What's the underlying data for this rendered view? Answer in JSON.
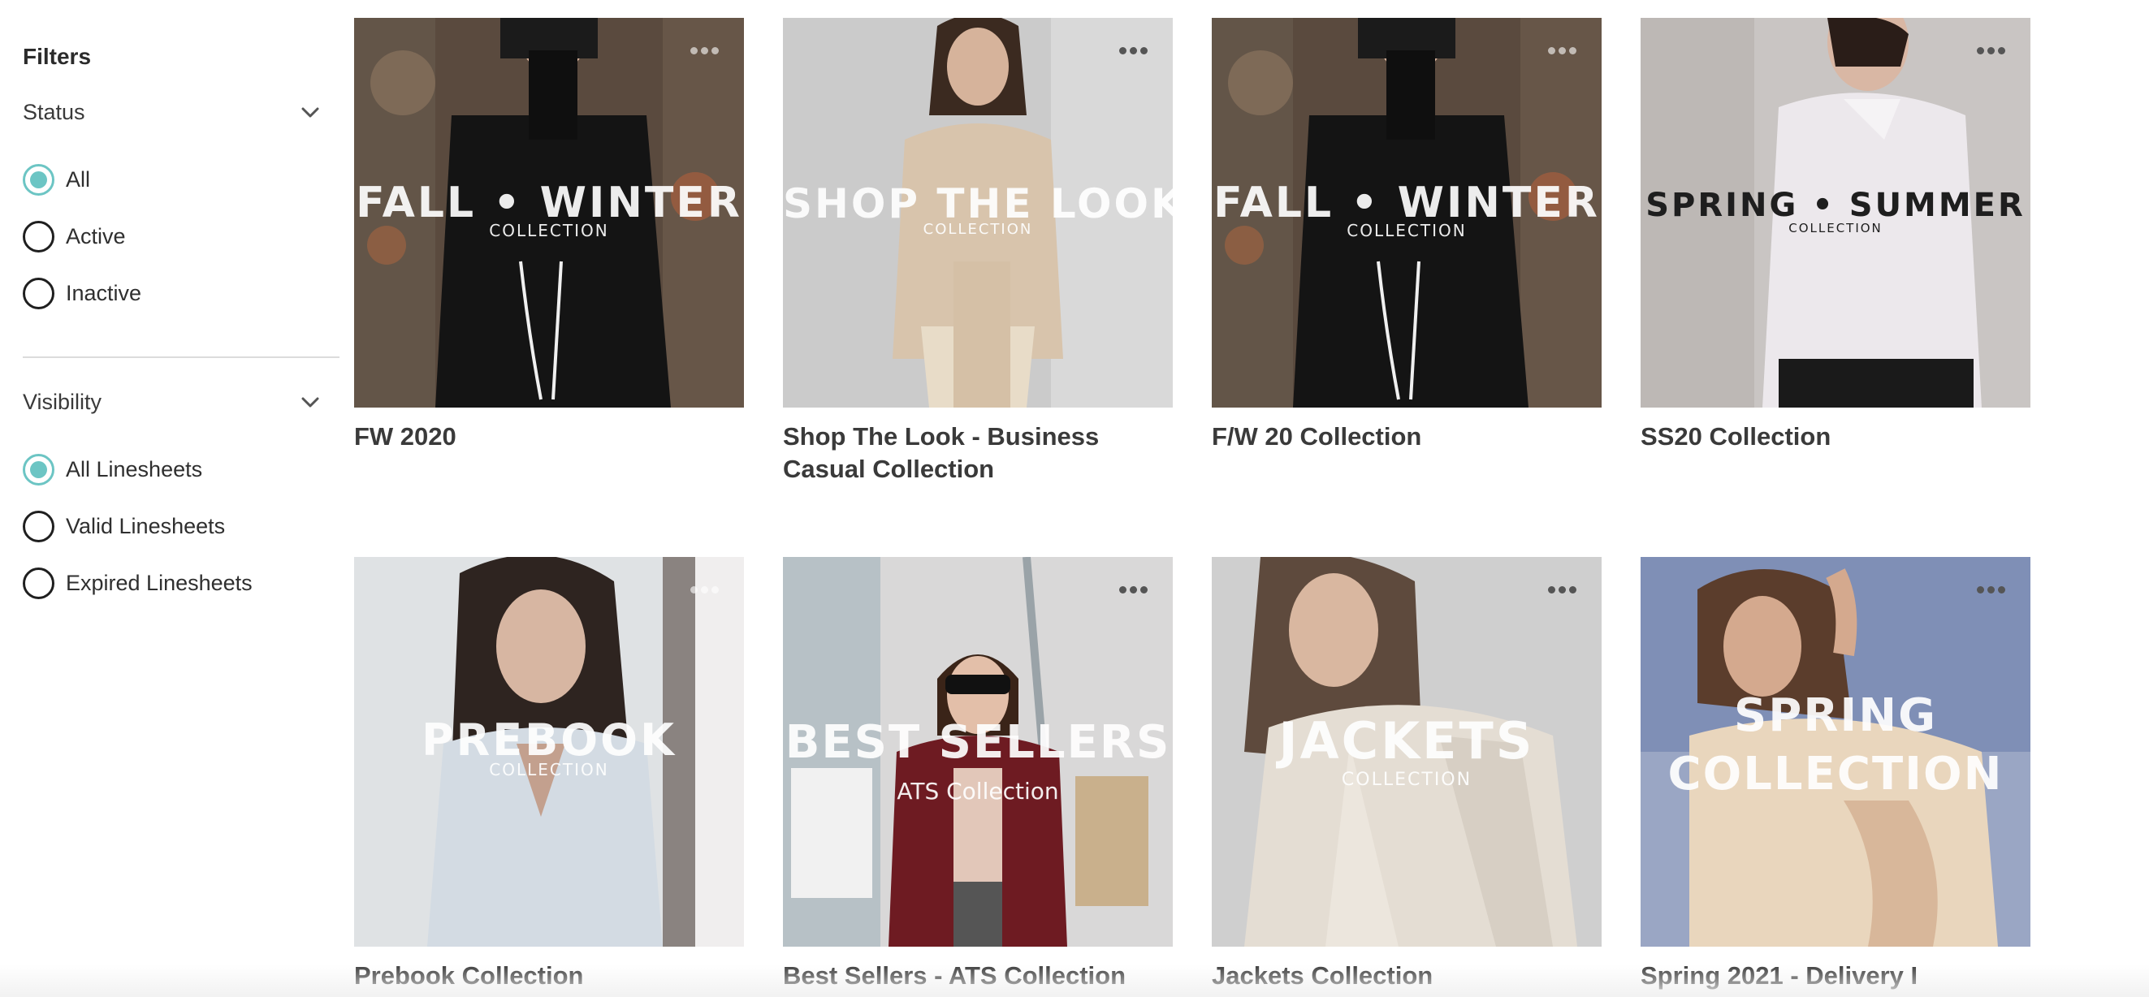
{
  "filters": {
    "title": "Filters",
    "sections": [
      {
        "label": "Status",
        "options": [
          {
            "label": "All",
            "checked": true
          },
          {
            "label": "Active",
            "checked": false
          },
          {
            "label": "Inactive",
            "checked": false
          }
        ]
      },
      {
        "label": "Visibility",
        "options": [
          {
            "label": "All Linesheets",
            "checked": true
          },
          {
            "label": "Valid Linesheets",
            "checked": false
          },
          {
            "label": "Expired Linesheets",
            "checked": false
          }
        ]
      }
    ]
  },
  "colors": {
    "accent": "#6cc5c4",
    "text": "#3a3a3a"
  },
  "linesheets": [
    {
      "title": "FW 2020",
      "overlay": "FALL • WINTER",
      "overlay_sub": "COLLECTION",
      "image": "woman-black-blazer-city-street",
      "overlay_color": "#ffffff"
    },
    {
      "title": "Shop The Look - Business Casual Collection",
      "overlay": "SHOP THE LOOK",
      "overlay_sub": "COLLECTION",
      "image": "woman-beige-knit-sweater",
      "overlay_color": "#ffffff"
    },
    {
      "title": "F/W 20 Collection",
      "overlay": "FALL • WINTER",
      "overlay_sub": "COLLECTION",
      "image": "woman-black-blazer-city-street",
      "overlay_color": "#ffffff"
    },
    {
      "title": "SS20 Collection",
      "overlay": "SPRING • SUMMER",
      "overlay_sub": "COLLECTION",
      "image": "woman-white-shirt",
      "overlay_color": "#1e1e1e"
    },
    {
      "title": "Prebook Collection",
      "overlay": "PREBOOK",
      "overlay_sub": "COLLECTION",
      "image": "woman-light-blue-shirt",
      "overlay_color": "#ffffff"
    },
    {
      "title": "Best Sellers - ATS Collection",
      "overlay": "BEST SELLERS",
      "overlay_sub": "ATS Collection",
      "image": "woman-sunglasses-red-coat-shopping",
      "overlay_color": "#ffffff"
    },
    {
      "title": "Jackets Collection",
      "overlay": "JACKETS",
      "overlay_sub": "COLLECTION",
      "image": "woman-cream-jacket",
      "overlay_color": "#ffffff"
    },
    {
      "title": "Spring 2021 - Delivery I",
      "overlay": "SPRING COLLECTION",
      "overlay_sub": "",
      "image": "woman-cream-blouse-blue-sky",
      "overlay_color": "#ffffff"
    }
  ]
}
